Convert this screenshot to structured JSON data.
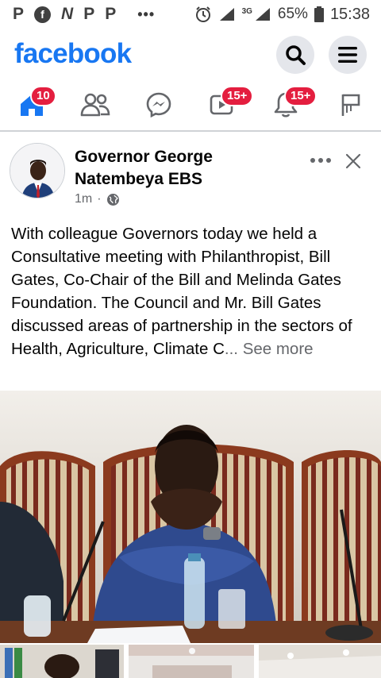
{
  "status_bar": {
    "left_icons": [
      "P",
      "f",
      "N",
      "P",
      "P"
    ],
    "more": "•••",
    "network": "3G",
    "battery": "65%",
    "time": "15:38"
  },
  "header": {
    "logo": "facebook",
    "search_icon": "search-icon",
    "menu_icon": "menu-icon"
  },
  "nav": {
    "tabs": [
      {
        "name": "home",
        "icon": "home-icon",
        "badge": "10"
      },
      {
        "name": "friends",
        "icon": "friends-icon",
        "badge": ""
      },
      {
        "name": "messenger",
        "icon": "messenger-icon",
        "badge": ""
      },
      {
        "name": "watch",
        "icon": "watch-icon",
        "badge": "15+"
      },
      {
        "name": "notifications",
        "icon": "bell-icon",
        "badge": "15+"
      },
      {
        "name": "pages",
        "icon": "flag-icon",
        "badge": ""
      }
    ],
    "active_color": "#1877f2"
  },
  "post": {
    "author": "Governor George Natembeya EBS",
    "time": "1m",
    "separator": "·",
    "audience_icon": "globe-icon",
    "text": "With colleague Governors today we  held a Consultative meeting with Philanthropist, Bill Gates, Co-Chair of the Bill and Melinda Gates Foundation. The Council and Mr. Bill Gates discussed areas of partnership in the sectors of Health, Agriculture, Climate C",
    "ellipsis": "...",
    "see_more": "See more"
  }
}
